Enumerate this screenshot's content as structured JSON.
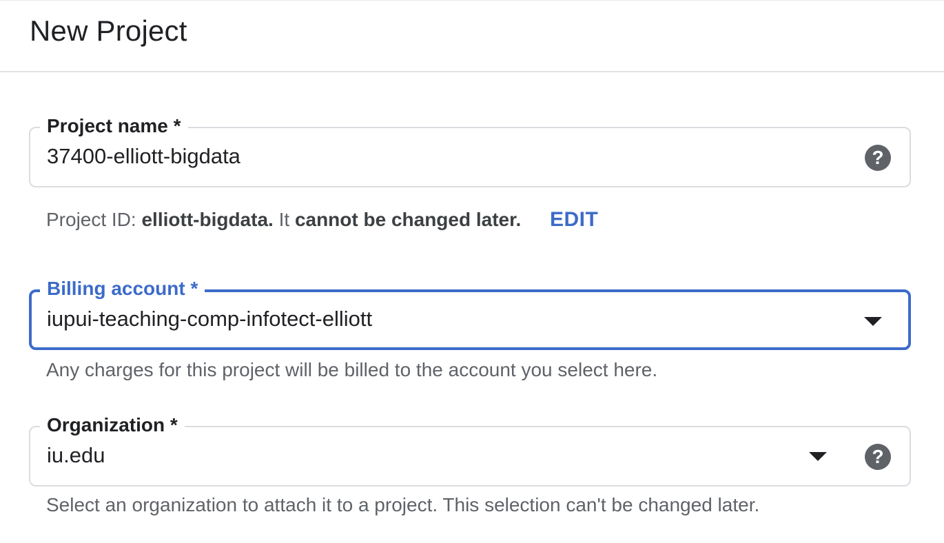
{
  "header": {
    "title": "New Project"
  },
  "project_name": {
    "label": "Project name *",
    "value": "37400-elliott-bigdata",
    "help_icon": "help-circle-icon"
  },
  "project_id": {
    "prefix": "Project ID: ",
    "id": "elliott-bigdata.",
    "middle": " It ",
    "emphasis": "cannot be changed later.",
    "edit_label": "EDIT"
  },
  "billing_account": {
    "label": "Billing account *",
    "value": "iupui-teaching-comp-infotect-elliott",
    "helper": "Any charges for this project will be billed to the account you select here.",
    "arrow_icon": "dropdown-arrow-icon"
  },
  "organization": {
    "label": "Organization *",
    "value": "iu.edu",
    "helper": "Select an organization to attach it to a project. This selection can't be changed later.",
    "arrow_icon": "dropdown-arrow-icon",
    "help_icon": "help-circle-icon"
  },
  "colors": {
    "accent": "#3c6bc9",
    "border": "#dadce0",
    "text": "#202124",
    "helper_text": "#5f6368",
    "icon": "#5f6368"
  }
}
